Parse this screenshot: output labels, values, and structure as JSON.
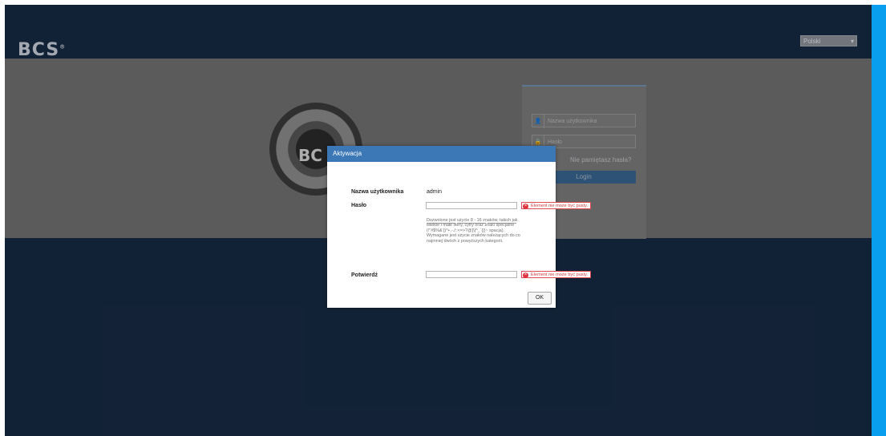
{
  "header": {
    "logo": "BCS",
    "logo_mark": "®",
    "language": "Polski"
  },
  "background": {
    "camera_label": "BC"
  },
  "login": {
    "username_placeholder": "Nazwa użytkownika",
    "password_placeholder": "Hasło",
    "forgot_label": "Nie pamiętasz hasła?",
    "button_label": "Login",
    "user_icon": "user-icon",
    "lock_icon": "lock-icon"
  },
  "modal": {
    "title": "Aktywacja",
    "username_label": "Nazwa użytkownika",
    "username_value": "admin",
    "password_label": "Hasło",
    "password_error": "Element nie może być pusty.",
    "hint": "Dozwolone jest użycie 8 - 16 znaków, takich jak wielkie i małe litery, cyfry oraz znaki specjalne (!\"#$%&'()*+,-./:;<=>?@[\\]^_`{|}~ spacja). Wymagane jest użycie znaków należących do co najmniej dwóch z powyższych kategorii.",
    "confirm_label": "Potwierdź",
    "confirm_error": "Element nie może być pusty.",
    "ok_label": "OK"
  },
  "colors": {
    "header_bg": "#172a43",
    "modal_header": "#3c77b6",
    "scrollbar": "#0a9eef",
    "error": "#e0323f"
  }
}
